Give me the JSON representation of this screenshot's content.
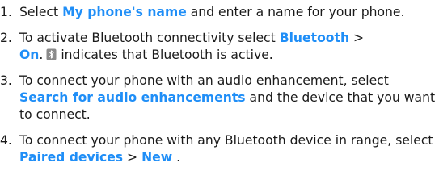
{
  "steps": [
    {
      "number": "1.",
      "before": "Select ",
      "kw1": "My phone's name",
      "after": " and enter a name for your phone."
    },
    {
      "number": "2.",
      "before": "To activate Bluetooth connectivity select ",
      "kw1": "Bluetooth",
      "sep": "  >",
      "kw2": "On",
      "mid": ".",
      "icon": "bluetooth-active-icon",
      "after": "indicates that Bluetooth is active."
    },
    {
      "number": "3.",
      "before": "To connect your phone with an audio enhancement, select ",
      "kw1": "Search for audio enhancements",
      "after": " and the device that you want to connect."
    },
    {
      "number": "4.",
      "before": "To connect your phone with any Bluetooth device in range, select ",
      "kw1": "Paired devices",
      "sep": "  >  ",
      "kw2": "New",
      "after": " ."
    }
  ],
  "colors": {
    "keyword": "#1f8ef7",
    "text": "#1a1a1a",
    "icon": "#8a8a8a"
  }
}
